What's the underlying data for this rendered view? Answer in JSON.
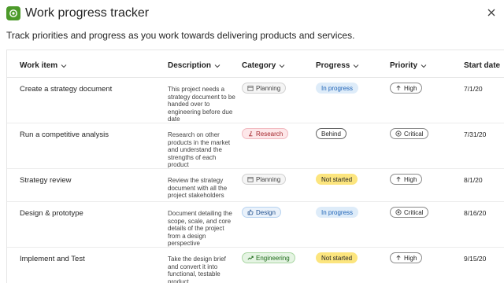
{
  "app": {
    "title": "Work progress tracker",
    "subtitle": "Track priorities and progress as you work towards delivering products and services."
  },
  "columns": [
    {
      "key": "work_item",
      "label": "Work item"
    },
    {
      "key": "description",
      "label": "Description"
    },
    {
      "key": "category",
      "label": "Category"
    },
    {
      "key": "progress",
      "label": "Progress"
    },
    {
      "key": "priority",
      "label": "Priority"
    },
    {
      "key": "start_date",
      "label": "Start date"
    }
  ],
  "rows": [
    {
      "work_item": "Create a strategy document",
      "description": "This project needs a strategy document to be handed over to engineering before due date",
      "category": {
        "label": "Planning",
        "icon": "calendar-icon"
      },
      "progress": "In progress",
      "priority": {
        "label": "High",
        "icon": "arrow-up-icon"
      },
      "start_date": "7/1/20"
    },
    {
      "work_item": "Run a competitive analysis",
      "description": "Research on other products in the market and understand the strengths of each product",
      "category": {
        "label": "Research",
        "icon": "microscope-icon"
      },
      "progress": "Behind",
      "priority": {
        "label": "Critical",
        "icon": "critical-icon"
      },
      "start_date": "7/31/20"
    },
    {
      "work_item": "Strategy review",
      "description": "Review the strategy document with all the project stakeholders",
      "category": {
        "label": "Planning",
        "icon": "calendar-icon"
      },
      "progress": "Not started",
      "priority": {
        "label": "High",
        "icon": "arrow-up-icon"
      },
      "start_date": "8/1/20"
    },
    {
      "work_item": "Design & prototype",
      "description": "Document detailing the scope, scale, and core details of the project from a design perspective",
      "category": {
        "label": "Design",
        "icon": "thumbs-up-icon"
      },
      "progress": "In progress",
      "priority": {
        "label": "Critical",
        "icon": "critical-icon"
      },
      "start_date": "8/16/20"
    },
    {
      "work_item": "Implement and Test",
      "description": "Take the design brief and convert it into functional, testable product",
      "category": {
        "label": "Engineering",
        "icon": "trend-icon"
      },
      "progress": "Not started",
      "priority": {
        "label": "High",
        "icon": "arrow-up-icon"
      },
      "start_date": "9/15/20"
    }
  ],
  "colors": {
    "app_icon": "#4c9a2a",
    "in_progress": "#deecf9",
    "not_started": "#fce57e",
    "research": "#fde7e9",
    "engineering": "#e5f4e3"
  }
}
